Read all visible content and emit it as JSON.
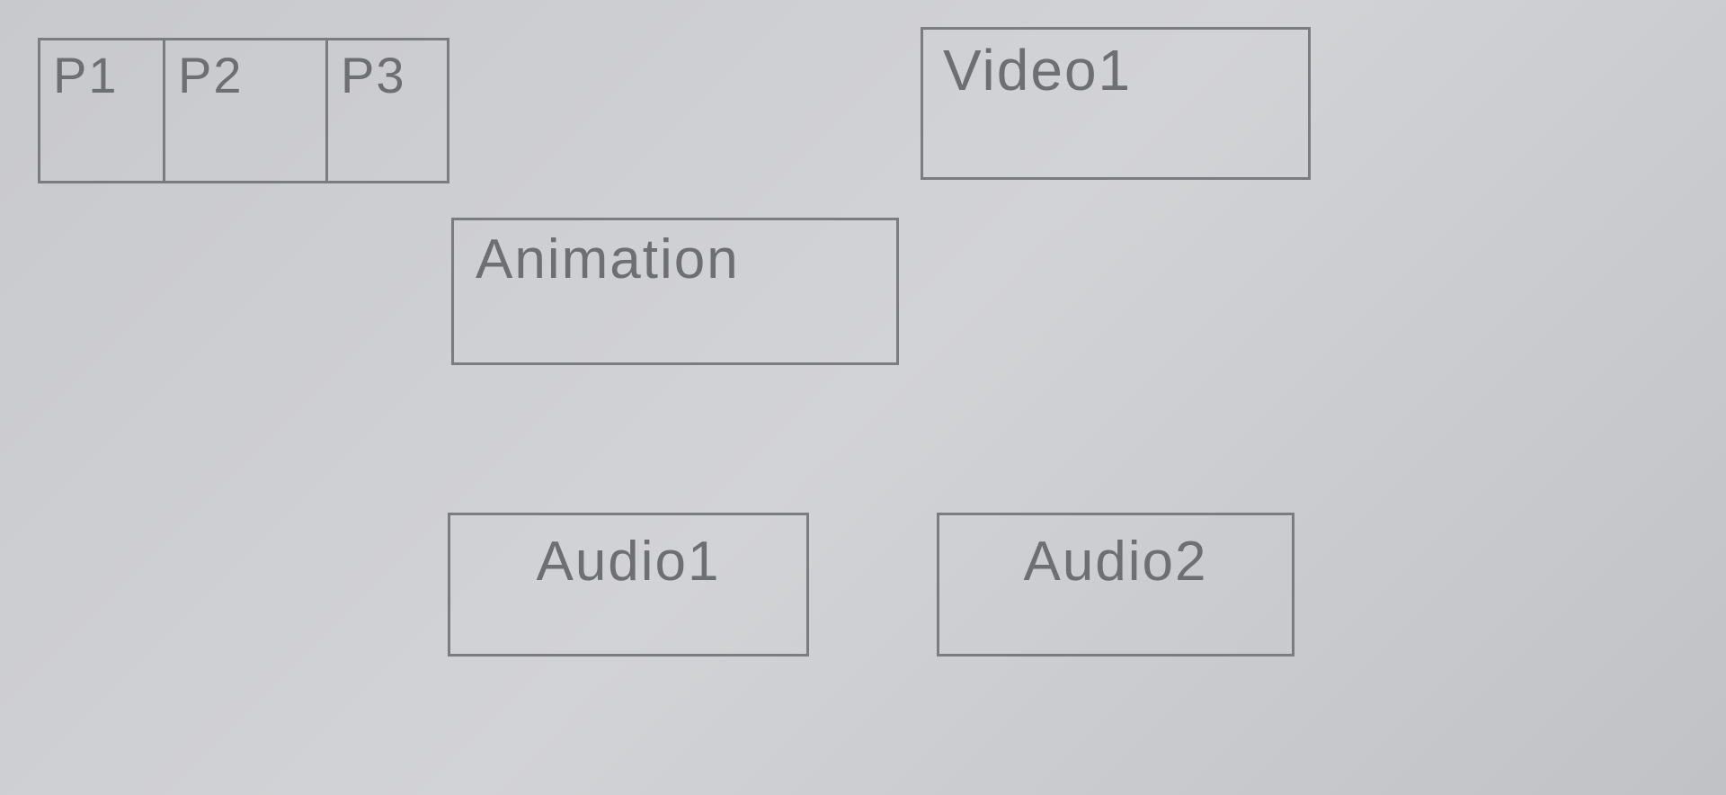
{
  "blocks": {
    "p1": "P1",
    "p2": "P2",
    "p3": "P3",
    "video1": "Video1",
    "animation": "Animation",
    "audio1": "Audio1",
    "audio2": "Audio2"
  }
}
